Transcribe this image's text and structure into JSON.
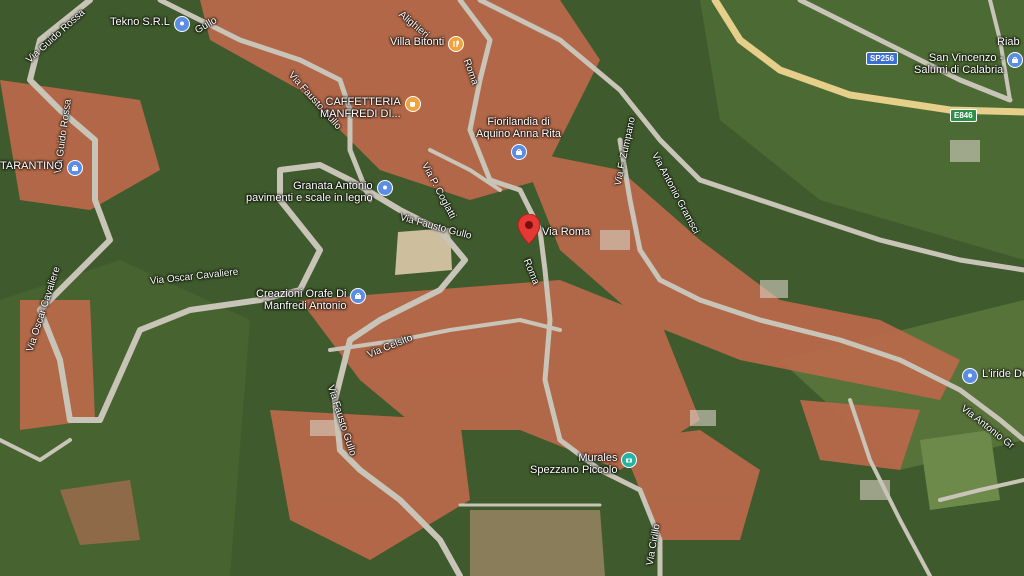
{
  "colors": {
    "vegetation": "#3f5a2c",
    "roofs": "#b8694a",
    "road": "#c9c4b8",
    "highway": "#e6cf8a",
    "marker_red": "#e53935",
    "poi_blue": "#5c8de6",
    "poi_orange": "#f2a23c",
    "poi_teal": "#26b3a6",
    "shield_blue": "#3b6fd4"
  },
  "selected_place": {
    "label": "Via Roma",
    "icon": "red-location-pin-icon"
  },
  "pois": [
    {
      "id": "tekno",
      "label": "Tekno S.R.L",
      "icon": "location-pin-icon",
      "color": "#5c8de6"
    },
    {
      "id": "villa-bitonti",
      "label": "Villa Bitonti",
      "icon": "restaurant-icon",
      "color": "#f2a23c"
    },
    {
      "id": "caffetteria",
      "label": "CAFFETTERIA\nMANFREDI DI...",
      "icon": "cafe-icon",
      "color": "#f2a23c"
    },
    {
      "id": "fiorilandia",
      "label": "Fiorilandia di\nAquino Anna Rita",
      "icon": "shopping-bag-icon",
      "color": "#5c8de6"
    },
    {
      "id": "granata",
      "label": "Granata Antonio\npavimenti e scale in legno",
      "icon": "location-pin-icon",
      "color": "#5c8de6"
    },
    {
      "id": "tarantino",
      "label": "TARANTINO",
      "icon": "shopping-bag-icon",
      "color": "#5c8de6"
    },
    {
      "id": "creazioni",
      "label": "Creazioni Orafe Di\nManfredi Antonio",
      "icon": "shopping-bag-icon",
      "color": "#5c8de6"
    },
    {
      "id": "san-vincenzo",
      "label": "San Vincenzo -\nSalumi di Calabria",
      "icon": "shopping-bag-icon",
      "color": "#5c8de6"
    },
    {
      "id": "riab",
      "label": "Riab",
      "icon": "location-pin-icon",
      "color": "#5c8de6"
    },
    {
      "id": "liride",
      "label": "L'iride De",
      "icon": "location-pin-icon",
      "color": "#5c8de6"
    },
    {
      "id": "murales",
      "label": "Murales\nSpezzano Piccolo",
      "icon": "camera-icon",
      "color": "#26b3a6"
    }
  ],
  "roads": [
    {
      "id": "guido-rossa-1",
      "label": "Via Guido Rossa"
    },
    {
      "id": "guido-rossa-2",
      "label": "Via Guido Rossa"
    },
    {
      "id": "fausto-gullo-1",
      "label": "Via Fausto Gullo"
    },
    {
      "id": "fausto-gullo-2",
      "label": "Via Fausto Gullo"
    },
    {
      "id": "fausto-gullo-3",
      "label": "Via Fausto Gullo"
    },
    {
      "id": "gullo-top",
      "label": "Gullo"
    },
    {
      "id": "alighieri",
      "label": "Alighieri"
    },
    {
      "id": "roma-top",
      "label": "Roma"
    },
    {
      "id": "roma-mid",
      "label": "Roma"
    },
    {
      "id": "coglatti",
      "label": "Via P. Coglatti"
    },
    {
      "id": "zumpano",
      "label": "Via F. Zumpano"
    },
    {
      "id": "gramsci-1",
      "label": "Via Antonio Gramsci"
    },
    {
      "id": "gramsci-2",
      "label": "Via Antonio Gr"
    },
    {
      "id": "cavaliere-1",
      "label": "Via Oscar Cavaliere"
    },
    {
      "id": "cavaliere-2",
      "label": "Via Oscar Cavaliere"
    },
    {
      "id": "celsito",
      "label": "Via Celsito"
    },
    {
      "id": "cirillo",
      "label": "Via Cirillo"
    }
  ],
  "shields": [
    {
      "id": "sp256",
      "label": "SP256"
    },
    {
      "id": "e846",
      "label": "E846"
    }
  ]
}
